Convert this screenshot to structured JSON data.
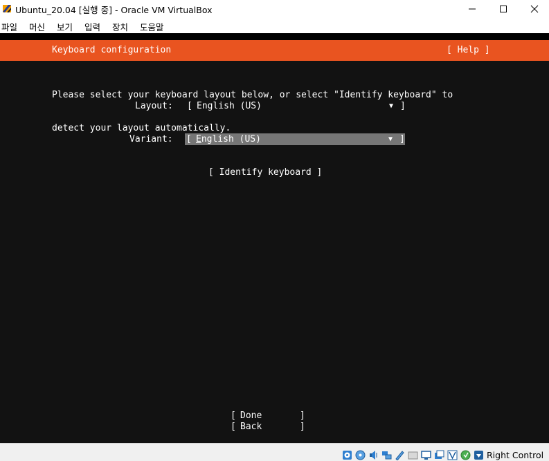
{
  "window": {
    "title": "Ubuntu_20.04 [실행 중] - Oracle VM VirtualBox",
    "icon": "virtualbox-icon"
  },
  "menu": [
    "파일",
    "머신",
    "보기",
    "입력",
    "장치",
    "도움말"
  ],
  "installer": {
    "header_title": "Keyboard configuration",
    "help_label": "[ Help ]",
    "description_line1": "Please select your keyboard layout below, or select \"Identify keyboard\" to",
    "description_line2": "detect your layout automatically.",
    "layout_label": "Layout:",
    "layout_value": "English (US)",
    "variant_label": "Variant:",
    "variant_value_first": "E",
    "variant_value_rest": "nglish (US)",
    "dropdown_arrow": "▼",
    "bracket_open": "[",
    "bracket_close": "]",
    "identify_label": "[ Identify keyboard ]",
    "done_label": "Done",
    "back_label": "Back"
  },
  "statusbar": {
    "host_key": "Right Control",
    "icons": [
      "hard-disk-icon",
      "optical-drive-icon",
      "audio-icon",
      "network-icon",
      "usb-icon",
      "shared-folders-icon",
      "display-icon",
      "recording-icon",
      "vt-x-icon",
      "mouse-integration-icon",
      "keyboard-capture-icon"
    ]
  },
  "colors": {
    "ubuntu_orange": "#e95420",
    "console_bg": "#121212",
    "selected_field_bg": "#767676",
    "statusbar_bg": "#f0f0f0"
  }
}
